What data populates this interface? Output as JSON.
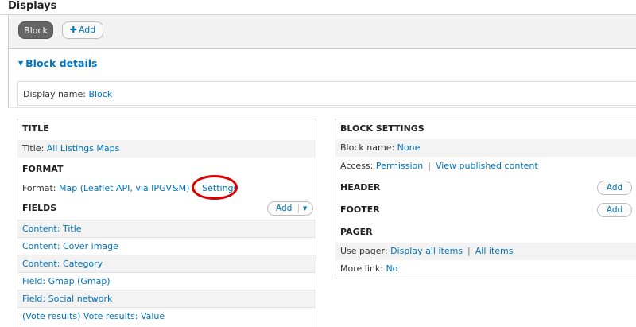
{
  "header": {
    "title": "Displays",
    "tabs": [
      {
        "label": "Block",
        "active": true
      },
      {
        "label": "Add",
        "icon": "plus-icon"
      }
    ]
  },
  "details": {
    "heading": "Block details",
    "display_name_label": "Display name:",
    "display_name_value": "Block"
  },
  "left": {
    "title_section": {
      "heading": "TITLE",
      "label": "Title:",
      "value": "All Listings Maps"
    },
    "format_section": {
      "heading": "FORMAT",
      "label": "Format:",
      "value": "Map (Leaflet API, via IPGV&M)",
      "separator": "|",
      "settings": "Settings"
    },
    "fields_section": {
      "heading": "FIELDS",
      "add_label": "Add",
      "items": [
        "Content: Title",
        "Content: Cover image",
        "Content: Category",
        "Field: Gmap (Gmap)",
        "Field: Social network",
        "(Vote results) Vote results: Value"
      ]
    }
  },
  "right": {
    "block_settings": {
      "heading": "BLOCK SETTINGS",
      "block_name_label": "Block name:",
      "block_name_value": "None",
      "access_label": "Access:",
      "access_value": "Permission",
      "separator": "|",
      "access_extra": "View published content"
    },
    "header_section": {
      "heading": "HEADER",
      "add_label": "Add"
    },
    "footer_section": {
      "heading": "FOOTER",
      "add_label": "Add"
    },
    "pager_section": {
      "heading": "PAGER",
      "use_pager_label": "Use pager:",
      "use_pager_value": "Display all items",
      "separator": "|",
      "use_pager_extra": "All items",
      "more_link_label": "More link:",
      "more_link_value": "No"
    }
  },
  "colors": {
    "link": "#0074bd",
    "active_tab": "#666666",
    "highlight_ring": "#d80000"
  }
}
